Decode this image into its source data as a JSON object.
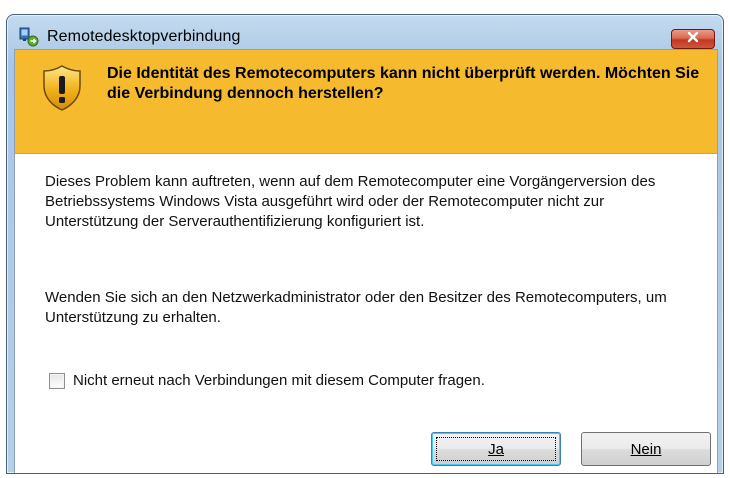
{
  "window": {
    "title": "Remotedesktopverbindung",
    "close_icon": "close-icon"
  },
  "banner": {
    "icon": "warning-shield-icon",
    "title": "Die Identität des Remotecomputers kann nicht überprüft werden. Möchten Sie die Verbindung dennoch herstellen?",
    "color": "#f5ba2e"
  },
  "body": {
    "paragraph1": "Dieses Problem kann auftreten, wenn auf dem Remotecomputer eine Vorgängerversion des Betriebssystems Windows Vista ausgeführt wird oder der Remotecomputer nicht zur Unterstützung der Serverauthentifizierung konfiguriert ist.",
    "paragraph2": "Wenden Sie sich an den Netzwerkadministrator oder den Besitzer des Remotecomputers, um Unterstützung zu erhalten."
  },
  "checkbox": {
    "label": "Nicht erneut nach Verbindungen mit diesem Computer fragen.",
    "checked": false
  },
  "buttons": {
    "yes_label": "Ja",
    "no_label": "Nein"
  }
}
